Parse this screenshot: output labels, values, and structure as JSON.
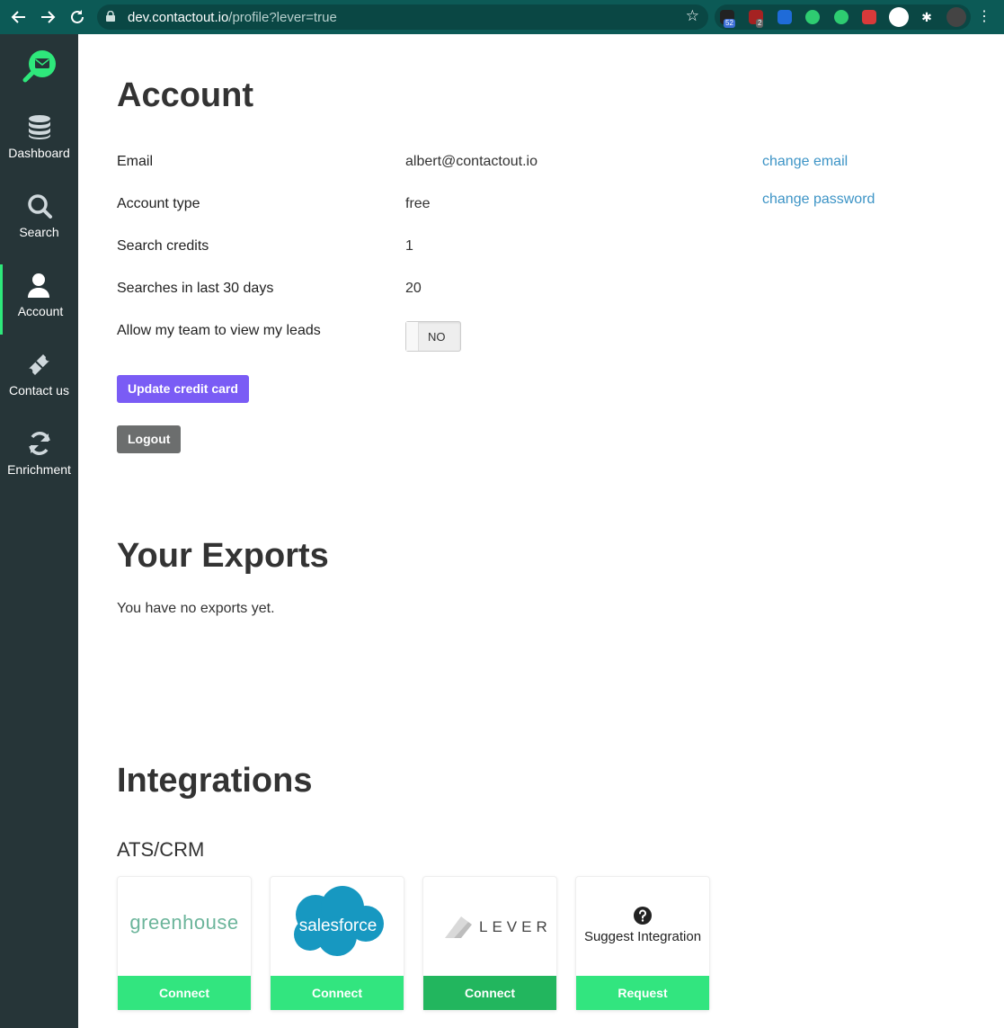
{
  "browser": {
    "url_host": "dev.contactout.io",
    "url_path": "/profile?lever=true",
    "ext_badge_1": "52",
    "ext_badge_2": "2"
  },
  "sidebar": {
    "items": [
      {
        "label": "Dashboard",
        "icon": "database-icon"
      },
      {
        "label": "Search",
        "icon": "search-icon"
      },
      {
        "label": "Account",
        "icon": "user-icon",
        "active": true
      },
      {
        "label": "Contact us",
        "icon": "ticket-icon"
      },
      {
        "label": "Enrichment",
        "icon": "refresh-icon"
      }
    ]
  },
  "account": {
    "title": "Account",
    "rows": [
      {
        "label": "Email",
        "value": "albert@contactout.io"
      },
      {
        "label": "Account type",
        "value": "free"
      },
      {
        "label": "Search credits",
        "value": "1"
      },
      {
        "label": "Searches in last 30 days",
        "value": "20"
      }
    ],
    "team_label": "Allow my team to view my leads",
    "team_toggle": "NO",
    "change_email": "change email",
    "change_password": "change password",
    "update_card": "Update credit card",
    "logout": "Logout"
  },
  "exports": {
    "title": "Your Exports",
    "empty": "You have no exports yet."
  },
  "integrations": {
    "title": "Integrations",
    "subtitle": "ATS/CRM",
    "cards": [
      {
        "logo_text": "greenhouse",
        "button": "Connect"
      },
      {
        "logo_text": "salesforce",
        "button": "Connect"
      },
      {
        "logo_text": "LEVER",
        "button": "Connect"
      },
      {
        "logo_text": "Suggest Integration",
        "button": "Request"
      }
    ]
  },
  "colors": {
    "sidebar": "#263538",
    "accent_green": "#32e57f",
    "purple": "#7a5cf5",
    "link": "#3d94c6"
  }
}
